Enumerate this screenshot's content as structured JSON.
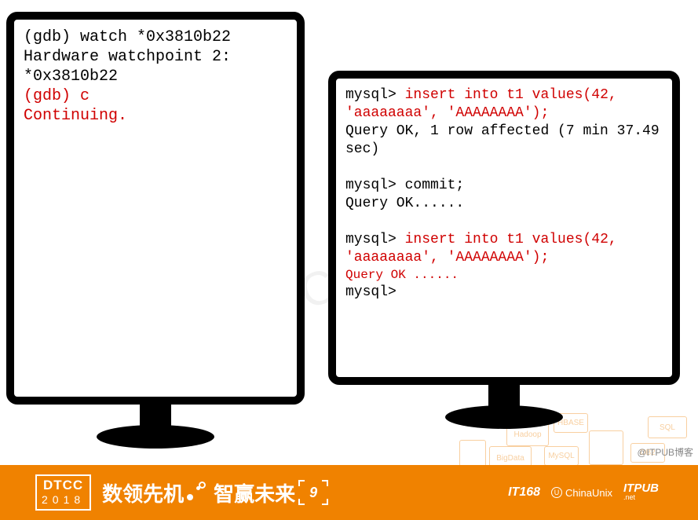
{
  "watermark": "DTCC2018",
  "left_terminal": {
    "l1": "(gdb) watch *0x3810b22",
    "l2": "Hardware watchpoint 2: *0x3810b22",
    "l3": "(gdb) c",
    "l4": "Continuing."
  },
  "right_terminal": {
    "l1a": "mysql> ",
    "l1b": "insert into t1 values(42, 'aaaaaaaa', 'AAAAAAAA');",
    "l2": "Query OK, 1 row affected (7 min 37.49 sec)",
    "blank1": " ",
    "l3": "mysql> commit;",
    "l4": "Query OK......",
    "blank2": " ",
    "l5a": "mysql> ",
    "l5b": "insert into t1 values(42, 'aaaaaaaa', 'AAAAAAAA');",
    "l6": "Query OK ......",
    "l7": "mysql>"
  },
  "banner": {
    "dtcc": "DTCC",
    "year": "2018",
    "slogan_a": "数领先机",
    "slogan_b": "智赢未来",
    "nine": "9",
    "brand_it168": "IT168",
    "brand_chinaunix": "ChinaUnix",
    "brand_u": "U",
    "brand_itpub": "ITPUB",
    "brand_itpub_sub": ".net"
  },
  "hex_labels": {
    "h1": "Hadoop",
    "h2": "BigData",
    "h3": "HBASE",
    "h4": "MySQL",
    "h5": "SQL",
    "h6": "DB2"
  },
  "side_label": "@ITPUB博客"
}
